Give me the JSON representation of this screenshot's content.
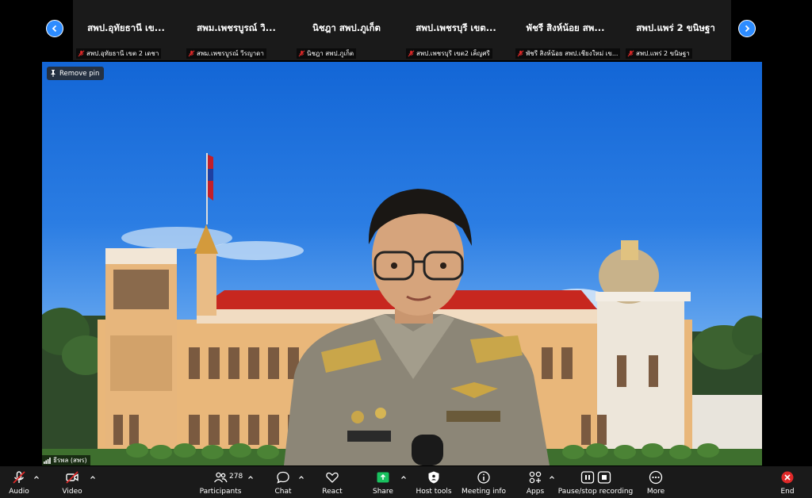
{
  "strip": {
    "tiles": [
      {
        "name": "สพป.อุทัยธานี เข...",
        "label": "สพป.อุทัยธานี เขต 2 เดชา"
      },
      {
        "name": "สพม.เพชรบูรณ์ วิ...",
        "label": "สพม.เพชรบูรณ์ วีรญาดา"
      },
      {
        "name": "นิชฎา สพป.ภูเก็ต",
        "label": "นิชฎา สพป.ภูเก็ต"
      },
      {
        "name": "สพป.เพชรบุรี เขต...",
        "label": "สพป.เพชรบุรี เขต2 เค็ญศรี"
      },
      {
        "name": "พัชรี สิงห์น้อย สพ...",
        "label": "พัชรี สิงห์น้อย สพป.เชียงใหม่ เข..."
      },
      {
        "name": "สพป.แพร่ 2 ขนิษฐา",
        "label": "สพป.แพร่ 2 ขนิษฐา"
      }
    ]
  },
  "video": {
    "remove_pin_label": "Remove pin",
    "speaker_name": "ธีรพล (สพร)"
  },
  "toolbar": {
    "audio": "Audio",
    "video": "Video",
    "participants": "Participants",
    "participants_count": "278",
    "chat": "Chat",
    "react": "React",
    "share": "Share",
    "host_tools": "Host tools",
    "meeting_info": "Meeting info",
    "apps": "Apps",
    "record": "Pause/stop recording",
    "more": "More",
    "end": "End"
  },
  "colors": {
    "accent": "#2d8cff",
    "muted_red": "#e02828",
    "share_green": "#19c15f",
    "end_red": "#e02828"
  }
}
